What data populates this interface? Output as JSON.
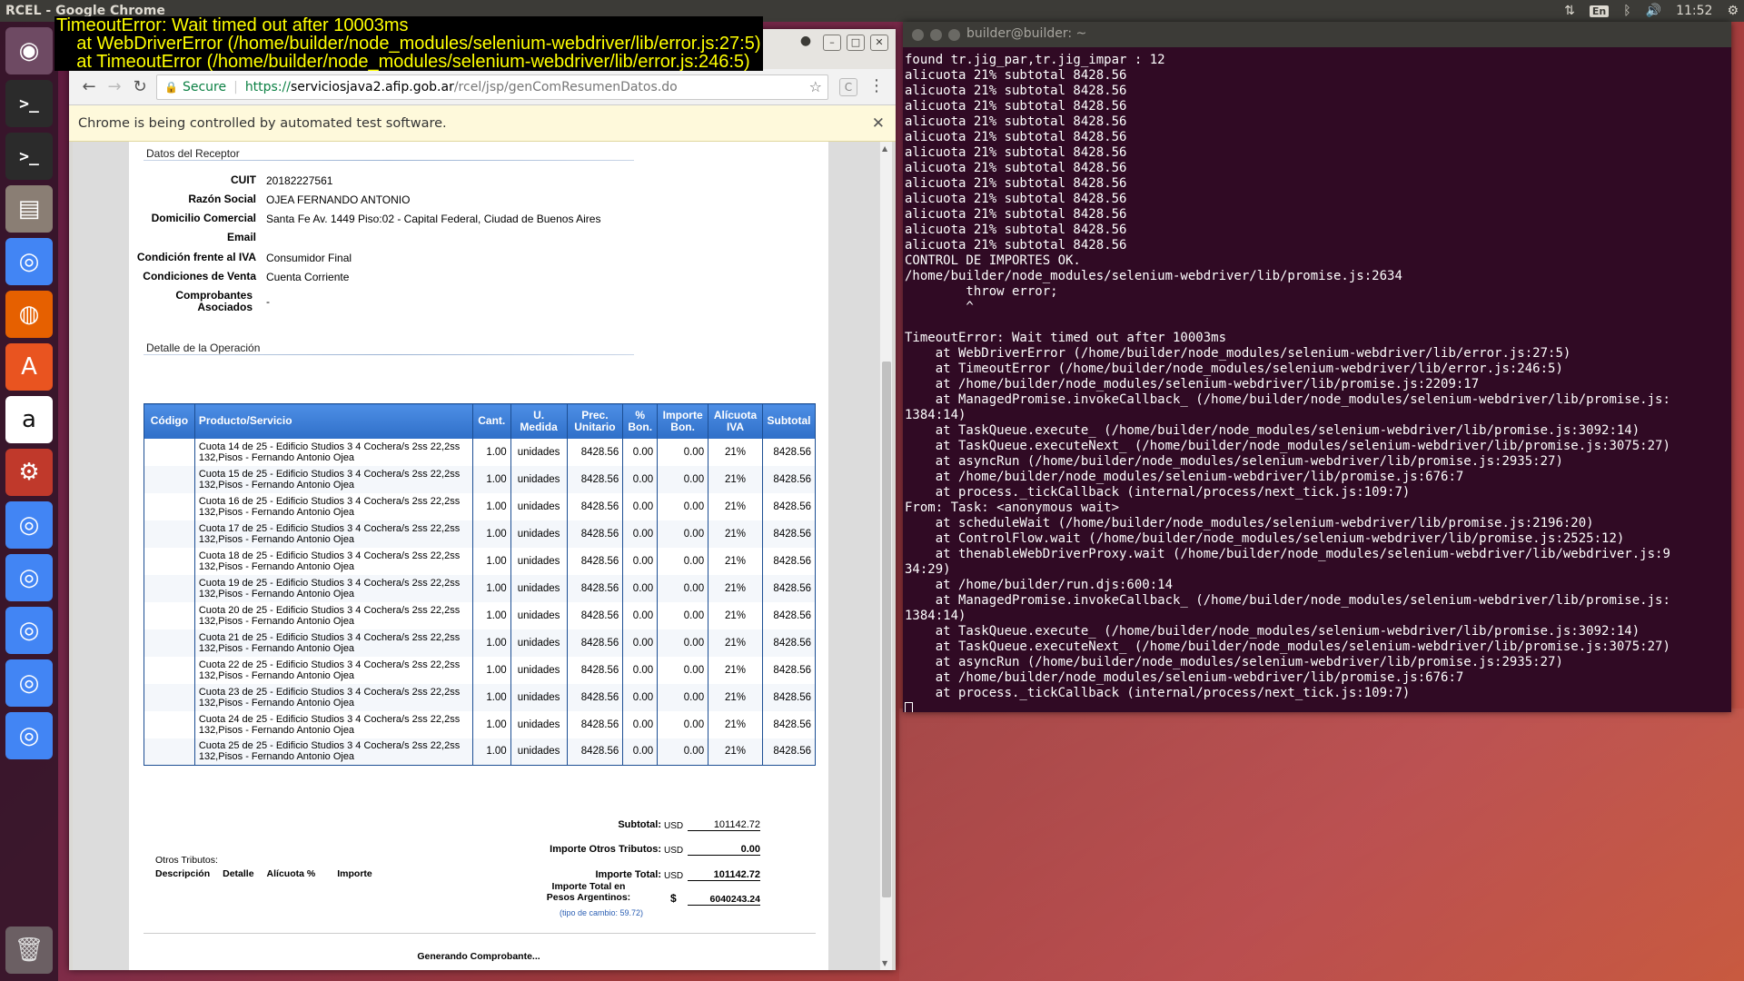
{
  "panel": {
    "title": "RCEL - Google Chrome",
    "keyboard": "En",
    "clock": "11:52"
  },
  "overlay_error": [
    "TimeoutError: Wait timed out after 10003ms",
    "    at WebDriverError (/home/builder/node_modules/selenium-webdriver/lib/error.js:27:5)",
    "    at TimeoutError (/home/builder/node_modules/selenium-webdriver/lib/error.js:246:5)"
  ],
  "chrome": {
    "secure_label": "Secure",
    "url_scheme": "https://",
    "url_host": "serviciosjava2.afip.gob.ar",
    "url_path": "/rcel/jsp/genComResumenDatos.do",
    "ext_label": "C",
    "infobar_text": "Chrome is being controlled by automated test software."
  },
  "receptor": {
    "section_title": "Datos del Receptor",
    "fields": [
      {
        "label": "CUIT",
        "value": "20182227561"
      },
      {
        "label": "Razón Social",
        "value": "OJEA FERNANDO ANTONIO"
      },
      {
        "label": "Domicilio Comercial",
        "value": "Santa Fe Av. 1449 Piso:02 - Capital Federal, Ciudad de Buenos Aires"
      },
      {
        "label": "Email",
        "value": ""
      },
      {
        "label": "Condición frente al IVA",
        "value": "Consumidor Final"
      },
      {
        "label": "Condiciones de Venta",
        "value": "Cuenta Corriente"
      },
      {
        "label": "Comprobantes Asociados",
        "value": "-"
      }
    ]
  },
  "operacion": {
    "section_title": "Detalle de la Operación",
    "headers": [
      "Código",
      "Producto/Servicio",
      "Cant.",
      "U. Medida",
      "Prec. Unitario",
      "% Bon.",
      "Importe Bon.",
      "Alícuota IVA",
      "Subtotal"
    ],
    "rows": [
      {
        "codigo": "",
        "producto": "Cuota 14 de 25 - Edificio Studios 3 4 Cochera/s 2ss 22,2ss 132,Pisos - Fernando Antonio Ojea",
        "cant": "1.00",
        "medida": "unidades",
        "precio": "8428.56",
        "bon": "0.00",
        "imp_bon": "0.00",
        "iva": "21%",
        "subtotal": "8428.56"
      },
      {
        "codigo": "",
        "producto": "Cuota 15 de 25 - Edificio Studios 3 4 Cochera/s 2ss 22,2ss 132,Pisos - Fernando Antonio Ojea",
        "cant": "1.00",
        "medida": "unidades",
        "precio": "8428.56",
        "bon": "0.00",
        "imp_bon": "0.00",
        "iva": "21%",
        "subtotal": "8428.56"
      },
      {
        "codigo": "",
        "producto": "Cuota 16 de 25 - Edificio Studios 3 4 Cochera/s 2ss 22,2ss 132,Pisos - Fernando Antonio Ojea",
        "cant": "1.00",
        "medida": "unidades",
        "precio": "8428.56",
        "bon": "0.00",
        "imp_bon": "0.00",
        "iva": "21%",
        "subtotal": "8428.56"
      },
      {
        "codigo": "",
        "producto": "Cuota 17 de 25 - Edificio Studios 3 4 Cochera/s 2ss 22,2ss 132,Pisos - Fernando Antonio Ojea",
        "cant": "1.00",
        "medida": "unidades",
        "precio": "8428.56",
        "bon": "0.00",
        "imp_bon": "0.00",
        "iva": "21%",
        "subtotal": "8428.56"
      },
      {
        "codigo": "",
        "producto": "Cuota 18 de 25 - Edificio Studios 3 4 Cochera/s 2ss 22,2ss 132,Pisos - Fernando Antonio Ojea",
        "cant": "1.00",
        "medida": "unidades",
        "precio": "8428.56",
        "bon": "0.00",
        "imp_bon": "0.00",
        "iva": "21%",
        "subtotal": "8428.56"
      },
      {
        "codigo": "",
        "producto": "Cuota 19 de 25 - Edificio Studios 3 4 Cochera/s 2ss 22,2ss 132,Pisos - Fernando Antonio Ojea",
        "cant": "1.00",
        "medida": "unidades",
        "precio": "8428.56",
        "bon": "0.00",
        "imp_bon": "0.00",
        "iva": "21%",
        "subtotal": "8428.56"
      },
      {
        "codigo": "",
        "producto": "Cuota 20 de 25 - Edificio Studios 3 4 Cochera/s 2ss 22,2ss 132,Pisos - Fernando Antonio Ojea",
        "cant": "1.00",
        "medida": "unidades",
        "precio": "8428.56",
        "bon": "0.00",
        "imp_bon": "0.00",
        "iva": "21%",
        "subtotal": "8428.56"
      },
      {
        "codigo": "",
        "producto": "Cuota 21 de 25 - Edificio Studios 3 4 Cochera/s 2ss 22,2ss 132,Pisos - Fernando Antonio Ojea",
        "cant": "1.00",
        "medida": "unidades",
        "precio": "8428.56",
        "bon": "0.00",
        "imp_bon": "0.00",
        "iva": "21%",
        "subtotal": "8428.56"
      },
      {
        "codigo": "",
        "producto": "Cuota 22 de 25 - Edificio Studios 3 4 Cochera/s 2ss 22,2ss 132,Pisos - Fernando Antonio Ojea",
        "cant": "1.00",
        "medida": "unidades",
        "precio": "8428.56",
        "bon": "0.00",
        "imp_bon": "0.00",
        "iva": "21%",
        "subtotal": "8428.56"
      },
      {
        "codigo": "",
        "producto": "Cuota 23 de 25 - Edificio Studios 3 4 Cochera/s 2ss 22,2ss 132,Pisos - Fernando Antonio Ojea",
        "cant": "1.00",
        "medida": "unidades",
        "precio": "8428.56",
        "bon": "0.00",
        "imp_bon": "0.00",
        "iva": "21%",
        "subtotal": "8428.56"
      },
      {
        "codigo": "",
        "producto": "Cuota 24 de 25 - Edificio Studios 3 4 Cochera/s 2ss 22,2ss 132,Pisos - Fernando Antonio Ojea",
        "cant": "1.00",
        "medida": "unidades",
        "precio": "8428.56",
        "bon": "0.00",
        "imp_bon": "0.00",
        "iva": "21%",
        "subtotal": "8428.56"
      },
      {
        "codigo": "",
        "producto": "Cuota 25 de 25 - Edificio Studios 3 4 Cochera/s 2ss 22,2ss 132,Pisos - Fernando Antonio Ojea",
        "cant": "1.00",
        "medida": "unidades",
        "precio": "8428.56",
        "bon": "0.00",
        "imp_bon": "0.00",
        "iva": "21%",
        "subtotal": "8428.56"
      }
    ]
  },
  "tributos": {
    "title": "Otros Tributos:",
    "headers": [
      "Descripción",
      "Detalle",
      "Alícuota %",
      "Importe"
    ]
  },
  "totales": {
    "subtotal_label": "Subtotal:",
    "subtotal_cur": "USD",
    "subtotal_val": "101142.72",
    "otros_label": "Importe Otros Tributos:",
    "otros_cur": "USD",
    "otros_val": "0.00",
    "total_label": "Importe Total:",
    "total_cur": "USD",
    "total_val": "101142.72",
    "pesos_label_1": "Importe Total en",
    "pesos_label_2": "Pesos Argentinos:",
    "pesos_cur": "$",
    "pesos_val": "6040243.24",
    "cambio": "(tipo de cambio: 59.72)"
  },
  "status_text": "Generando Comprobante...",
  "terminal": {
    "title": "builder@builder: ~",
    "lines": [
      "found tr.jig_par,tr.jig_impar : 12",
      "alicuota 21% subtotal 8428.56",
      "alicuota 21% subtotal 8428.56",
      "alicuota 21% subtotal 8428.56",
      "alicuota 21% subtotal 8428.56",
      "alicuota 21% subtotal 8428.56",
      "alicuota 21% subtotal 8428.56",
      "alicuota 21% subtotal 8428.56",
      "alicuota 21% subtotal 8428.56",
      "alicuota 21% subtotal 8428.56",
      "alicuota 21% subtotal 8428.56",
      "alicuota 21% subtotal 8428.56",
      "alicuota 21% subtotal 8428.56",
      "CONTROL DE IMPORTES OK.",
      "/home/builder/node_modules/selenium-webdriver/lib/promise.js:2634",
      "        throw error;",
      "        ^",
      "",
      "TimeoutError: Wait timed out after 10003ms",
      "    at WebDriverError (/home/builder/node_modules/selenium-webdriver/lib/error.js:27:5)",
      "    at TimeoutError (/home/builder/node_modules/selenium-webdriver/lib/error.js:246:5)",
      "    at /home/builder/node_modules/selenium-webdriver/lib/promise.js:2209:17",
      "    at ManagedPromise.invokeCallback_ (/home/builder/node_modules/selenium-webdriver/lib/promise.js:",
      "1384:14)",
      "    at TaskQueue.execute_ (/home/builder/node_modules/selenium-webdriver/lib/promise.js:3092:14)",
      "    at TaskQueue.executeNext_ (/home/builder/node_modules/selenium-webdriver/lib/promise.js:3075:27)",
      "    at asyncRun (/home/builder/node_modules/selenium-webdriver/lib/promise.js:2935:27)",
      "    at /home/builder/node_modules/selenium-webdriver/lib/promise.js:676:7",
      "    at process._tickCallback (internal/process/next_tick.js:109:7)",
      "From: Task: <anonymous wait>",
      "    at scheduleWait (/home/builder/node_modules/selenium-webdriver/lib/promise.js:2196:20)",
      "    at ControlFlow.wait (/home/builder/node_modules/selenium-webdriver/lib/promise.js:2525:12)",
      "    at thenableWebDriverProxy.wait (/home/builder/node_modules/selenium-webdriver/lib/webdriver.js:9",
      "34:29)",
      "    at /home/builder/run.djs:600:14",
      "    at ManagedPromise.invokeCallback_ (/home/builder/node_modules/selenium-webdriver/lib/promise.js:",
      "1384:14)",
      "    at TaskQueue.execute_ (/home/builder/node_modules/selenium-webdriver/lib/promise.js:3092:14)",
      "    at TaskQueue.executeNext_ (/home/builder/node_modules/selenium-webdriver/lib/promise.js:3075:27)",
      "    at asyncRun (/home/builder/node_modules/selenium-webdriver/lib/promise.js:2935:27)",
      "    at /home/builder/node_modules/selenium-webdriver/lib/promise.js:676:7",
      "    at process._tickCallback (internal/process/next_tick.js:109:7)"
    ]
  },
  "launcher": [
    {
      "icon": "ubuntu-dash-icon",
      "glyph": "◉",
      "bg": "#6e4a63"
    },
    {
      "icon": "terminal-icon",
      "glyph": ">_",
      "bg": "#2b2b2b"
    },
    {
      "icon": "terminal-icon",
      "glyph": ">_",
      "bg": "#2b2b2b"
    },
    {
      "icon": "files-icon",
      "glyph": "▤",
      "bg": "#8a7e74"
    },
    {
      "icon": "chrome-icon",
      "glyph": "◎",
      "bg": "#4285f4"
    },
    {
      "icon": "firefox-icon",
      "glyph": "◍",
      "bg": "#e66000"
    },
    {
      "icon": "software-center-icon",
      "glyph": "A",
      "bg": "#e95420"
    },
    {
      "icon": "amazon-icon",
      "glyph": "a",
      "bg": "#ffffff"
    },
    {
      "icon": "system-settings-icon",
      "glyph": "⚙",
      "bg": "#c0392b"
    },
    {
      "icon": "chrome-icon",
      "glyph": "◎",
      "bg": "#4285f4"
    },
    {
      "icon": "chrome-icon",
      "glyph": "◎",
      "bg": "#4285f4"
    },
    {
      "icon": "chrome-icon",
      "glyph": "◎",
      "bg": "#4285f4"
    },
    {
      "icon": "chrome-icon",
      "glyph": "◎",
      "bg": "#4285f4"
    },
    {
      "icon": "chrome-icon",
      "glyph": "◎",
      "bg": "#4285f4"
    }
  ],
  "trash": {
    "icon": "trash-icon",
    "glyph": "🗑"
  }
}
